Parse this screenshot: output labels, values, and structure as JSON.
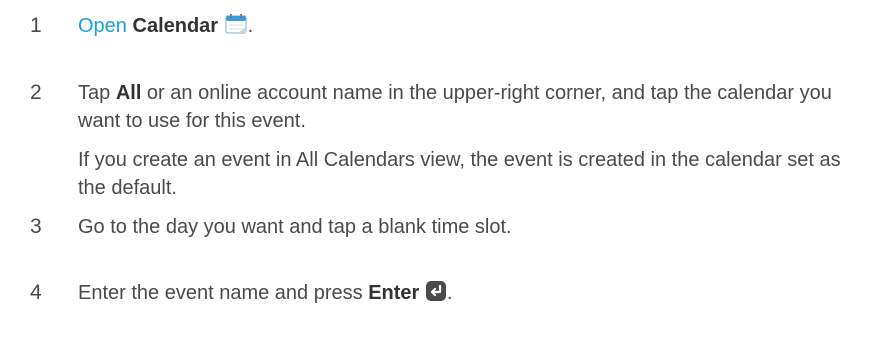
{
  "steps": [
    {
      "number": "1",
      "link_text": "Open",
      "bold_text": "Calendar",
      "end_text": ".",
      "icon": "calendar-icon"
    },
    {
      "number": "2",
      "before_bold": "Tap ",
      "bold_text": "All",
      "after_bold": " or an online account name in the upper-right corner, and tap the calendar you want to use for this event.",
      "note": "If you create an event in All Calendars view, the event is created in the calendar set as the default."
    },
    {
      "number": "3",
      "text": "Go to the day you want and tap a blank time slot."
    },
    {
      "number": "4",
      "before_bold": "Enter the event name and press ",
      "bold_text": "Enter",
      "end_text": ".",
      "icon": "enter-key-icon"
    }
  ],
  "colors": {
    "link": "#1aa0d9",
    "text": "#4a4a4a",
    "bold": "#333333",
    "enter_key": "#4a4a4a",
    "calendar_icon": "#3a9bd9"
  }
}
